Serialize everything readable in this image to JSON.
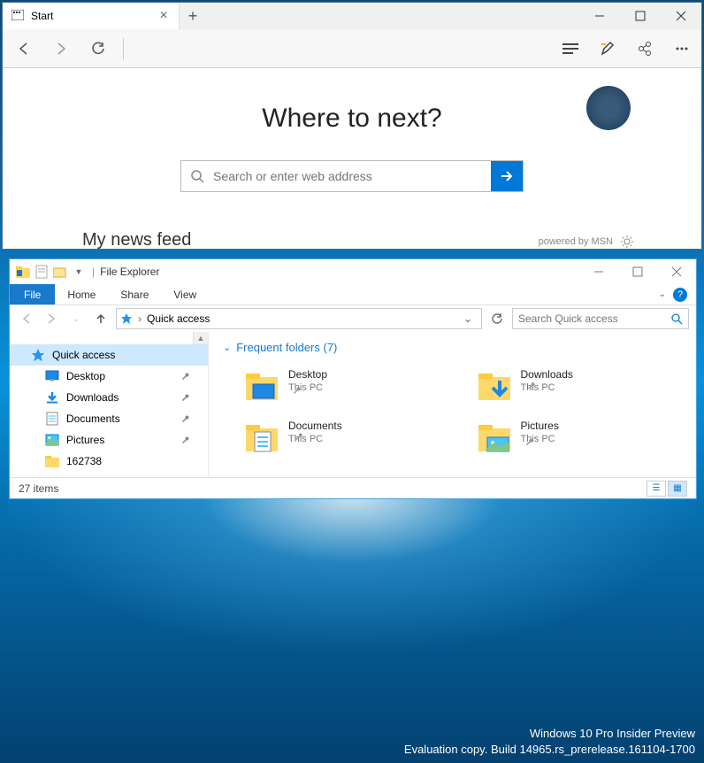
{
  "edge": {
    "tab_title": "Start",
    "headline": "Where to next?",
    "search_placeholder": "Search or enter web address",
    "news_feed": "My news feed",
    "powered": "powered by MSN"
  },
  "explorer": {
    "title": "File Explorer",
    "tabs": {
      "file": "File",
      "home": "Home",
      "share": "Share",
      "view": "View"
    },
    "address": "Quick access",
    "search_placeholder": "Search Quick access",
    "section_header": "Frequent folders (7)",
    "nav": [
      {
        "label": "Quick access",
        "icon": "star"
      },
      {
        "label": "Desktop",
        "icon": "desktop",
        "pinned": true
      },
      {
        "label": "Downloads",
        "icon": "download",
        "pinned": true
      },
      {
        "label": "Documents",
        "icon": "document",
        "pinned": true
      },
      {
        "label": "Pictures",
        "icon": "picture",
        "pinned": true
      },
      {
        "label": "162738",
        "icon": "folder",
        "pinned": false
      }
    ],
    "folders": [
      {
        "name": "Desktop",
        "loc": "This PC",
        "icon": "desktop"
      },
      {
        "name": "Downloads",
        "loc": "This PC",
        "icon": "download"
      },
      {
        "name": "Documents",
        "loc": "This PC",
        "icon": "document"
      },
      {
        "name": "Pictures",
        "loc": "This PC",
        "icon": "picture"
      }
    ],
    "status": "27 items"
  },
  "watermark": {
    "line1": "Windows 10 Pro Insider Preview",
    "line2": "Evaluation copy. Build 14965.rs_prerelease.161104-1700"
  }
}
